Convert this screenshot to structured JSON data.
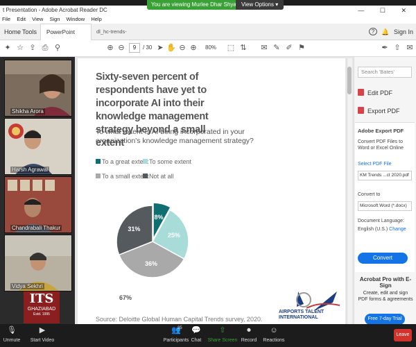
{
  "share": {
    "banner": "You are viewing Murlee Dhar Shyam's screen",
    "view_options": "View Options ▾"
  },
  "window": {
    "title": "t Presentation - Adobe Acrobat Reader DC",
    "controls": "— ☐ ✕"
  },
  "menu": [
    "File",
    "Edit",
    "View",
    "Sign",
    "Window",
    "Help"
  ],
  "tabs": {
    "home": "Home",
    "tools": "Tools",
    "active": "PowerPoint Present...",
    "active_close": "×",
    "other": "dl_hc-trends-2020..."
  },
  "header_right": {
    "help": "?",
    "bell": "🔔",
    "sign_in": "Sign In"
  },
  "toolbar": {
    "page_current": "9",
    "page_total": "/ 30",
    "zoom": "80%"
  },
  "participants": [
    {
      "name": "Shikha Arora"
    },
    {
      "name": "Harsh Agrawal"
    },
    {
      "name": "Chandrabali Thakur"
    },
    {
      "name": "Vidya Sekhri"
    }
  ],
  "slide": {
    "title": "Sixty-seven percent of respondents have yet to incorporate AI into their knowledge management strategy beyond a small extent",
    "subtitle": "To what extent is AI being incorporated in your organization's knowledge management strategy?",
    "legend": [
      {
        "label": "To a great extent",
        "color": "#0e6e72"
      },
      {
        "label": "To some extent",
        "color": "#a7dcd9"
      },
      {
        "label": "To a small extent",
        "color": "#a9a9a9"
      },
      {
        "label": "Not at all",
        "color": "#555a5f"
      }
    ],
    "total_label": "67%",
    "source": "Source: Deloitte Global Human Capital Trends survey, 2020.",
    "its": {
      "main": "ITS",
      "sub": "GHAZIABAD",
      "est": "Estd. 1995"
    },
    "ati": {
      "line1": "AIRPORTS TALENT",
      "line2": "INTERNATIONAL"
    }
  },
  "chart_data": {
    "type": "pie",
    "title": "",
    "slices": [
      {
        "label": "To a great extent",
        "value": 8,
        "color": "#0e6e72",
        "text": "8%"
      },
      {
        "label": "To some extent",
        "value": 25,
        "color": "#a7dcd9",
        "text": "25%"
      },
      {
        "label": "To a small extent",
        "value": 36,
        "color": "#a9a9a9",
        "text": "36%"
      },
      {
        "label": "Not at all",
        "value": 31,
        "color": "#555a5f",
        "text": "31%"
      }
    ],
    "legend_placement": "top"
  },
  "right_panel": {
    "search_placeholder": "Search 'Bates'",
    "edit_pdf": "Edit PDF",
    "export_pdf": "Export PDF",
    "export_header": "Adobe Export PDF",
    "export_desc": "Convert PDF Files to Word or Excel Online",
    "select_file": "Select PDF File",
    "file_name": "KM Trends ...ct 2020.pdf",
    "convert_to": "Convert to",
    "convert_format": "Microsoft Word (*.docx)",
    "doc_lang_label": "Document Language:",
    "doc_lang_value": "English (U.S.)",
    "change": "Change",
    "convert_btn": "Convert",
    "pro_title": "Acrobat Pro with E-Sign",
    "pro_desc": "Create, edit and sign PDF forms & agreements",
    "trial_btn": "Free 7-day Trial"
  },
  "zoom_bar": {
    "unmute": "Unmute",
    "start_video": "Start Video",
    "participants": "Participants",
    "participants_count": "35",
    "chat": "Chat",
    "share_screen": "Share Screen",
    "record": "Record",
    "reactions": "Reactions",
    "leave": "Leave"
  }
}
